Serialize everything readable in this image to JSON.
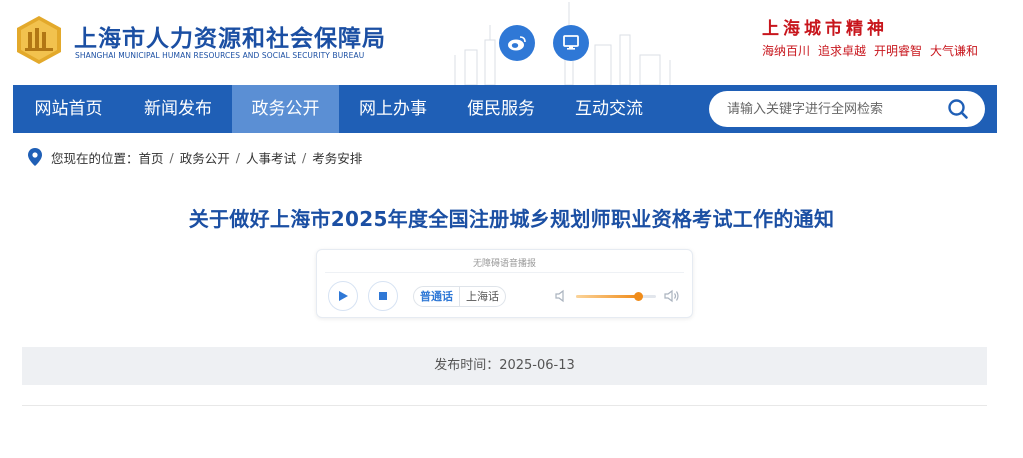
{
  "header": {
    "org_name_cn": "上海市人力资源和社会保障局",
    "org_name_en": "SHANGHAI MUNICIPAL HUMAN RESOURCES AND SOCIAL SECURITY BUREAU",
    "spirit_title": "上海城市精神",
    "spirit_words": [
      "海纳百川",
      "追求卓越",
      "开明睿智",
      "大气谦和"
    ],
    "logo_icon": "bureau-emblem-icon",
    "weibo_icon": "weibo-icon",
    "pc_icon": "desktop-icon"
  },
  "nav": {
    "items": [
      {
        "label": "网站首页",
        "active": false
      },
      {
        "label": "新闻发布",
        "active": false
      },
      {
        "label": "政务公开",
        "active": true
      },
      {
        "label": "网上办事",
        "active": false
      },
      {
        "label": "便民服务",
        "active": false
      },
      {
        "label": "互动交流",
        "active": false
      }
    ],
    "search_placeholder": "请输入关键字进行全网检索"
  },
  "breadcrumb": {
    "prefix": "您现在的位置：",
    "items": [
      "首页",
      "政务公开",
      "人事考试",
      "考务安排"
    ],
    "separator": "/"
  },
  "article": {
    "title": "关于做好上海市2025年度全国注册城乡规划师职业资格考试工作的通知",
    "date_text": "发布时间：2025-06-13"
  },
  "player": {
    "label": "无障碍语音播报",
    "lang_active": "普通话",
    "lang_other": "上海话",
    "volume_fraction": 0.78
  },
  "colors": {
    "brand_blue": "#1f5fb6",
    "nav_active": "#5b8fd4",
    "title_blue": "#1b4fa3",
    "spirit_red": "#c8161d",
    "volume_orange": "#f08c1a"
  }
}
